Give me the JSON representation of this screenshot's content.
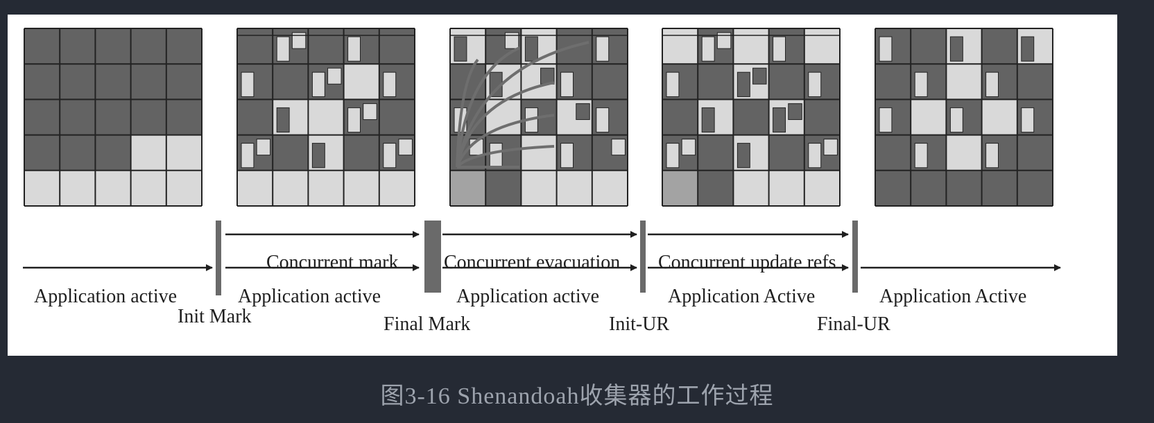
{
  "caption": "图3-16    Shenandoah收集器的工作过程",
  "phases": [
    {
      "label": "Concurrent mark"
    },
    {
      "label": "Concurrent evacuation"
    },
    {
      "label": "Concurrent update refs"
    }
  ],
  "app_labels": [
    "Application active",
    "Application active",
    "Application active",
    "Application Active",
    "Application Active"
  ],
  "pauses": [
    "Init Mark",
    "Final Mark",
    "Init-UR",
    "Final-UR"
  ],
  "colors": {
    "background": "#252a34",
    "panel": "#ffffff",
    "region_dark": "#636363",
    "region_light": "#d9d9d9",
    "region_mid": "#a3a3a3",
    "grid_line": "#222222",
    "pause_bar": "#6a6a6a",
    "ref_arrow": "#6e6e6e",
    "caption": "#9da3ad"
  }
}
